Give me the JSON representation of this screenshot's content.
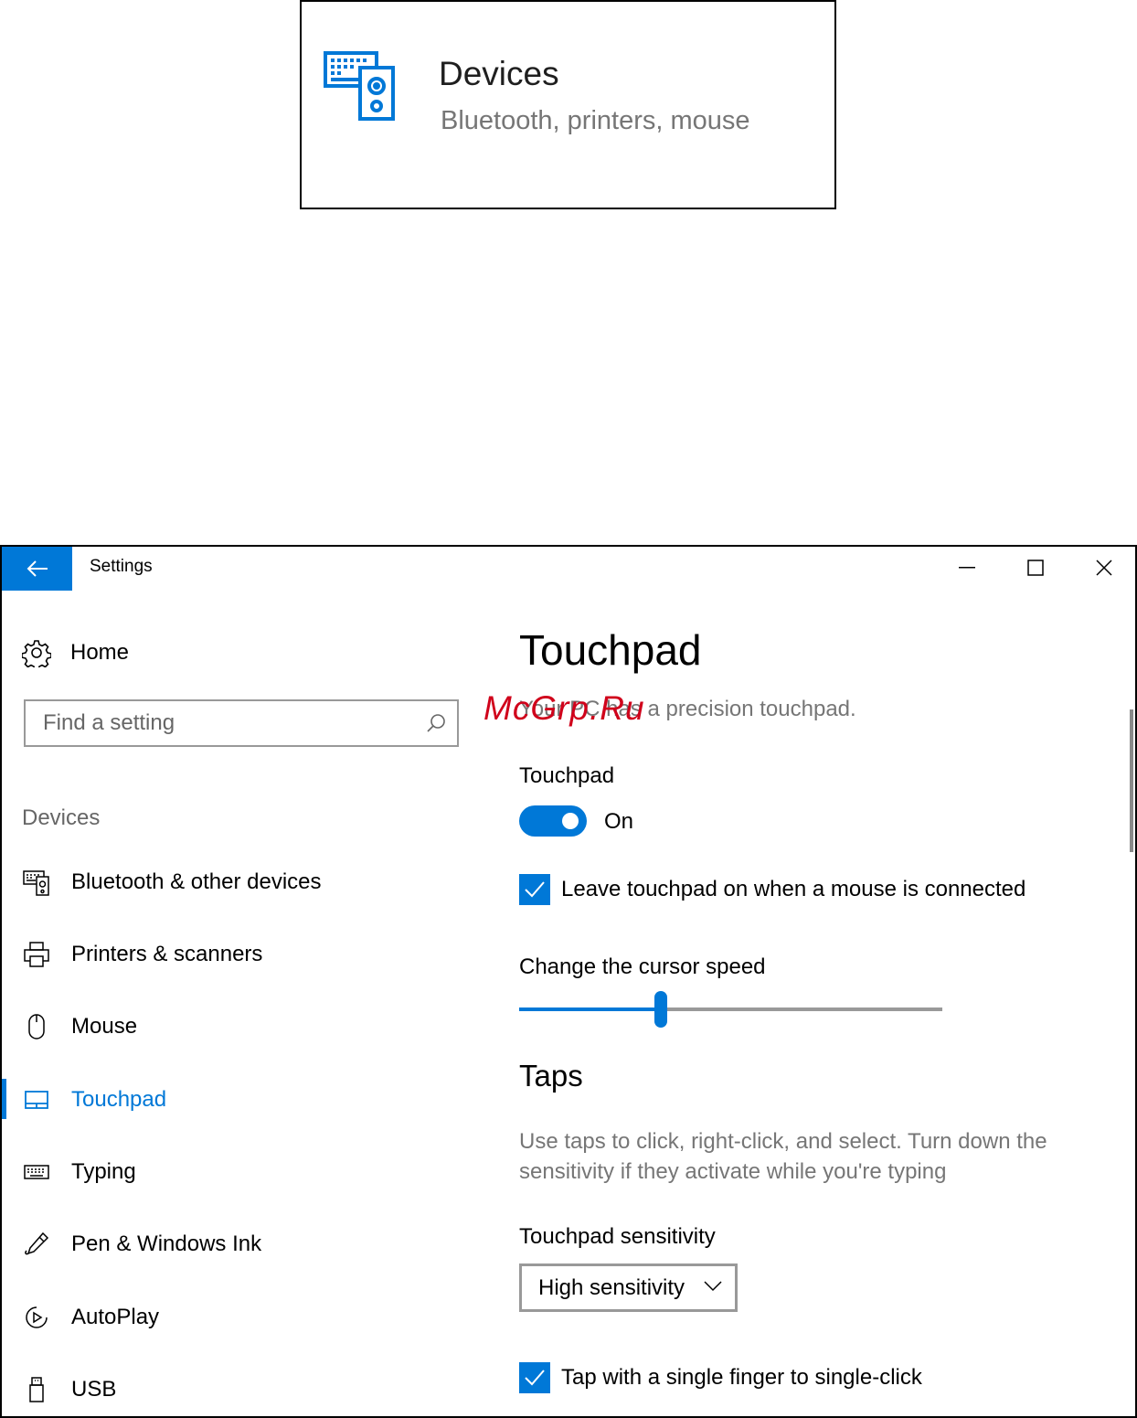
{
  "tile": {
    "icon": "devices-icon",
    "title": "Devices",
    "subtitle": "Bluetooth, printers, mouse"
  },
  "window": {
    "title": "Settings",
    "controls": [
      "minimize-icon",
      "maximize-icon",
      "close-icon"
    ],
    "accent_color": "#0078d7"
  },
  "sidebar": {
    "home_label": "Home",
    "search_placeholder": "Find a setting",
    "section_label": "Devices",
    "items": [
      {
        "label": "Bluetooth & other devices",
        "icon": "bluetooth-devices-icon"
      },
      {
        "label": "Printers & scanners",
        "icon": "printer-icon"
      },
      {
        "label": "Mouse",
        "icon": "mouse-icon"
      },
      {
        "label": "Touchpad",
        "icon": "touchpad-icon",
        "active": true
      },
      {
        "label": "Typing",
        "icon": "keyboard-icon"
      },
      {
        "label": "Pen & Windows Ink",
        "icon": "pen-icon"
      },
      {
        "label": "AutoPlay",
        "icon": "autoplay-icon"
      },
      {
        "label": "USB",
        "icon": "usb-icon"
      }
    ]
  },
  "content": {
    "title": "Touchpad",
    "description": "Your PC has a precision touchpad.",
    "watermark": "McGrp.Ru",
    "touchpad_label": "Touchpad",
    "toggle_state": "On",
    "toggle_on": true,
    "leave_on_label": "Leave touchpad on when a mouse is connected",
    "leave_on_checked": true,
    "cursor_speed_label": "Change the cursor speed",
    "cursor_speed_fraction": 0.335,
    "taps_title": "Taps",
    "taps_description": "Use taps to click, right-click, and select. Turn down the sensitivity if they activate while you're typing",
    "sensitivity_label": "Touchpad sensitivity",
    "sensitivity_value": "High sensitivity",
    "single_tap_label": "Tap with a single finger to single-click",
    "single_tap_checked": true
  }
}
